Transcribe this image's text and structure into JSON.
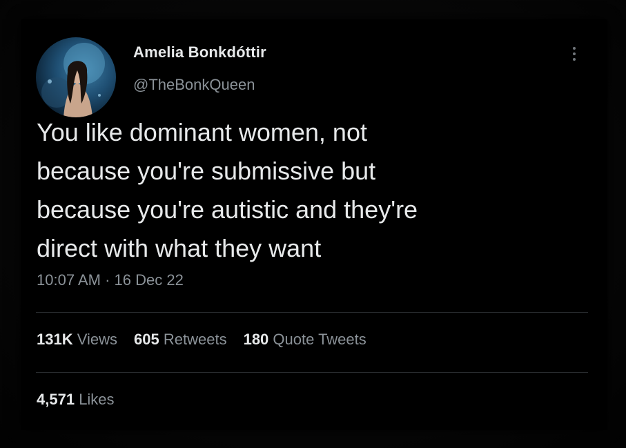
{
  "tweet": {
    "author": {
      "display_name": "Amelia Bonkdóttir",
      "handle": "@TheBonkQueen"
    },
    "text_lines": [
      "You like dominant women, not",
      "because you're submissive but",
      "because you're autistic and they're",
      "direct with what they want"
    ],
    "time": "10:07 AM",
    "separator": "·",
    "date": "16 Dec 22",
    "stats": {
      "views_count": "131K",
      "views_label": "Views",
      "retweets_count": "605",
      "retweets_label": "Retweets",
      "quotes_count": "180",
      "quotes_label": "Quote Tweets",
      "likes_count": "4,571",
      "likes_label": "Likes"
    }
  },
  "icons": {
    "more": "more-options-icon"
  },
  "colors": {
    "background": "#000000",
    "text_primary": "#e7e9ea",
    "text_secondary": "#8b9298",
    "divider": "#2a2d30"
  }
}
